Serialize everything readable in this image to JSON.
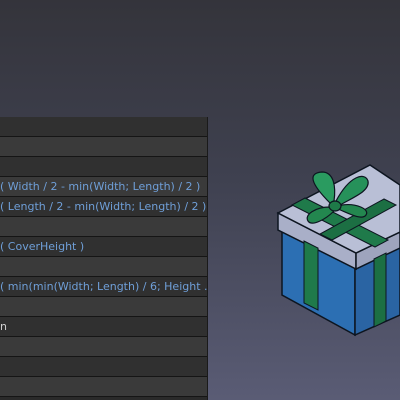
{
  "property_panel": {
    "rows": [
      {
        "text": ""
      },
      {
        "text": ""
      },
      {
        "text": ""
      },
      {
        "text": "( Width / 2 - min(Width; Length) / 2 )"
      },
      {
        "text": "  ( Length / 2 - min(Width; Length) / 2 )"
      },
      {
        "text": ""
      },
      {
        "text": "( CoverHeight )"
      },
      {
        "text": ""
      },
      {
        "text": "( min(min(Width; Length) / 6; Height ..."
      },
      {
        "text": ""
      },
      {
        "text": "n"
      },
      {
        "text": ""
      },
      {
        "text": ""
      },
      {
        "text": ""
      }
    ]
  },
  "viewport": {
    "model": "gift-box",
    "colors": {
      "box": "#2e75bb",
      "lid": "#b9bfd6",
      "ribbon": "#1f7a4a"
    }
  }
}
